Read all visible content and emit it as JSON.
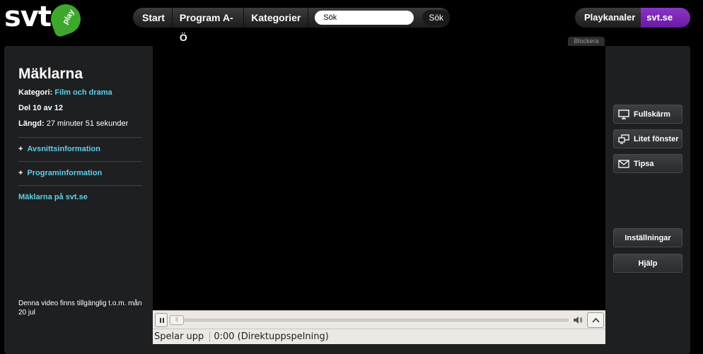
{
  "header": {
    "logo_text": "svt",
    "logo_badge": "play",
    "nav": [
      "Start",
      "Program A-Ö",
      "Kategorier"
    ],
    "search": {
      "value": "Sök",
      "button_label": "Sök"
    },
    "channels_label": "Playkanaler",
    "svtse_label": "svt.se",
    "blockera_label": "Blockera"
  },
  "program": {
    "title": "Mäklarna",
    "category_label": "Kategori:",
    "category_value": "Film och drama",
    "episode": "Del 10 av 12",
    "length_label": "Längd:",
    "length_value": "27 minuter 51 sekunder",
    "expanders": [
      "Avsnittsinformation",
      "Programinformation"
    ],
    "page_link": "Mäklarna på svt.se",
    "availability": "Denna video finns tillgänglig t.o.m. mån 20 jul"
  },
  "player": {
    "status": "Spelar upp",
    "time": "0:00 (Direktuppspelning)",
    "progress": 0
  },
  "side_buttons": {
    "fullscreen": "Fullskärm",
    "small_window": "Litet fönster",
    "share": "Tipsa",
    "settings": "Inställningar",
    "help": "Hjälp"
  },
  "colors": {
    "accent_link": "#5fd0ea",
    "brand_green": "#3ea82c",
    "svtse_purple": "#7a28b4"
  }
}
